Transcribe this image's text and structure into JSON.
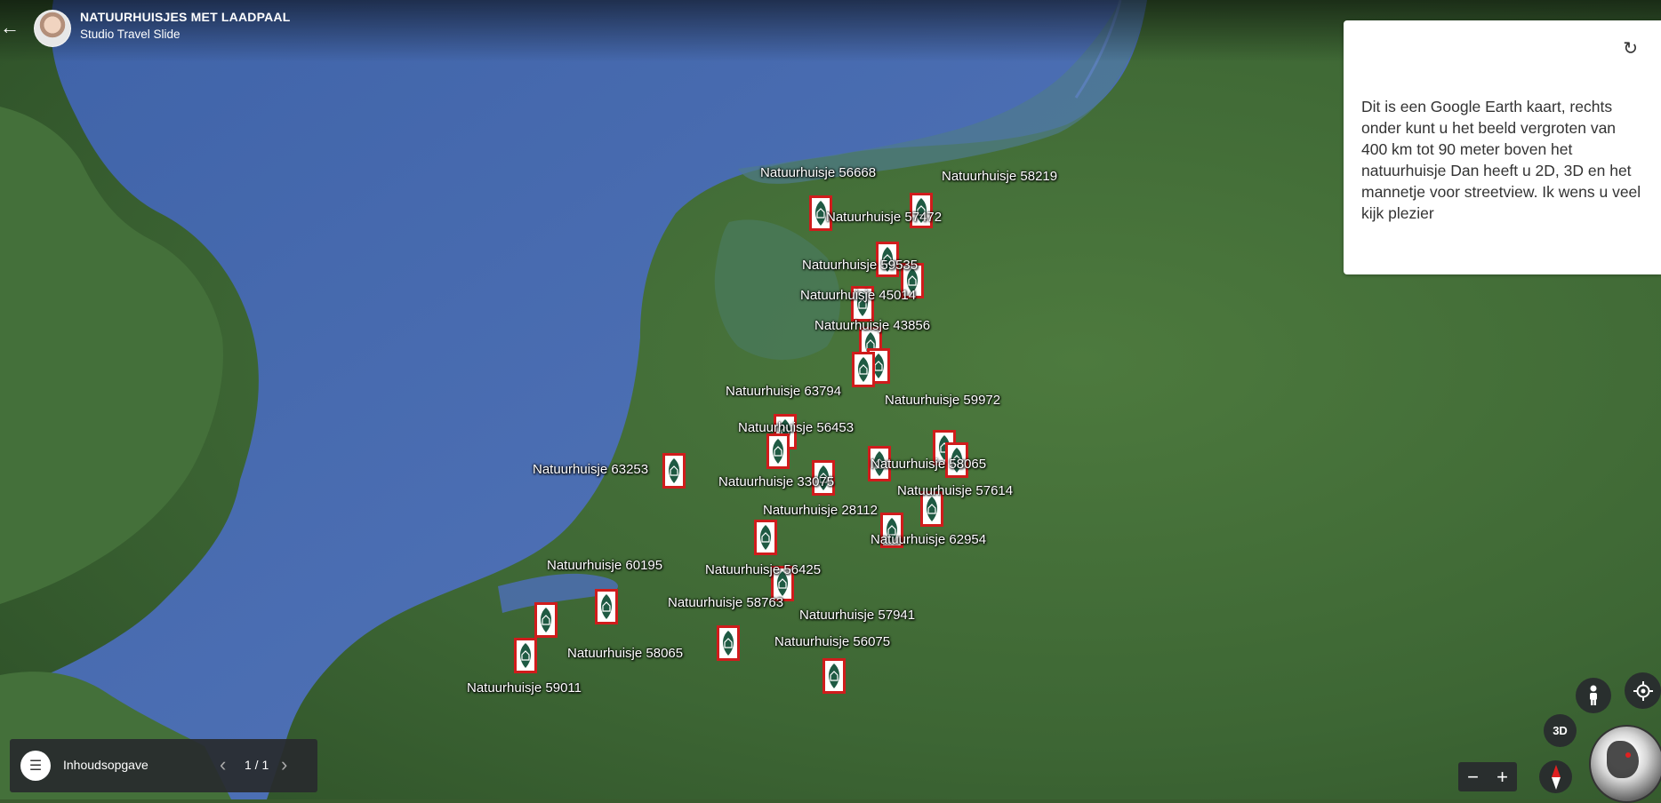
{
  "header": {
    "back_icon": "arrow-left-icon",
    "avatar_icon": "avatar-icon",
    "title": "NATUURHUISJES MET LAADPAAL",
    "subtitle": "Studio Travel Slide"
  },
  "info_panel": {
    "refresh_icon": "refresh-icon",
    "text": "Dit is een Google Earth kaart, rechts onder kunt u het beeld vergroten van 400 km tot 90 meter boven het natuurhuisje Dan heeft u 2D, 3D en het mannetje voor streetview. Ik wens u veel kijk plezier"
  },
  "map": {
    "labels": [
      "Natuurhuisje 56668",
      "Natuurhuisje 58219",
      "Natuurhuisje 57472",
      "Natuurhuisje 59535",
      "Natuurhuisje 45014",
      "Natuurhuisje 43856",
      "Natuurhuisje 63794",
      "Natuurhuisje 59972",
      "Natuurhuisje 56453",
      "Natuurhuisje 63253",
      "Natuurhuisje 58065",
      "Natuurhuisje 33075",
      "Natuurhuisje 57614",
      "Natuurhuisje 28112",
      "Natuurhuisje 62954",
      "Natuurhuisje 60195",
      "Natuurhuisje 56425",
      "Natuurhuisje 58763",
      "Natuurhuisje 57941",
      "Natuurhuisje 58065",
      "Natuurhuisje 56075",
      "Natuurhuisje 59011"
    ],
    "marker_icon": "leaf-house-icon",
    "colors": {
      "water": "#4c6fb4",
      "land": "#3f6a35",
      "marker_border": "#d01c1c",
      "leaf": "#1f5a43"
    }
  },
  "footer": {
    "toc_icon": "list-icon",
    "toc_label": "Inhoudsopgave",
    "prev_icon": "chevron-left-icon",
    "next_icon": "chevron-right-icon",
    "page_count": "1 / 1"
  },
  "controls": {
    "pegman_icon": "pegman-icon",
    "locate_icon": "locate-icon",
    "view_mode_label": "3D",
    "zoom_out_label": "−",
    "zoom_in_label": "+",
    "compass_icon": "compass-icon",
    "globe_icon": "globe-icon"
  }
}
